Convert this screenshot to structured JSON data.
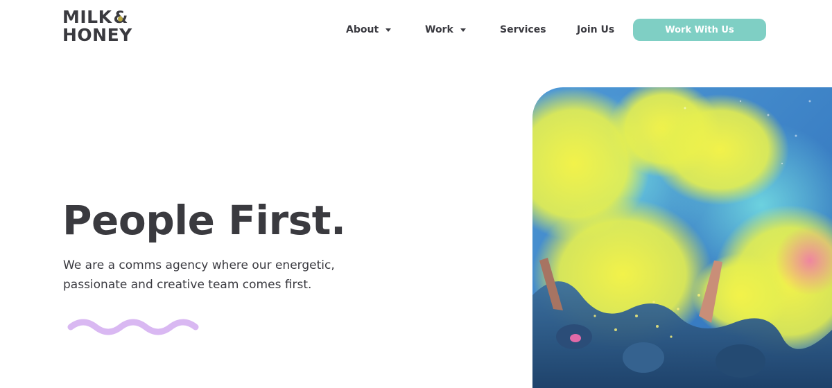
{
  "brand": {
    "logo_line1": "MILK",
    "logo_amp": "&",
    "logo_line2": "HONEY"
  },
  "nav": {
    "items": [
      {
        "label": "About",
        "has_dropdown": true
      },
      {
        "label": "Work",
        "has_dropdown": true
      },
      {
        "label": "Services",
        "has_dropdown": false
      },
      {
        "label": "Join Us",
        "has_dropdown": false
      }
    ],
    "cta_label": "Work With Us"
  },
  "hero": {
    "title": "People First.",
    "subtitle": "We are a comms agency where our energetic, passionate and creative team comes first."
  },
  "colors": {
    "accent": "#7fcfc4",
    "wave": "#d9b8f2",
    "text": "#3a3a40"
  }
}
